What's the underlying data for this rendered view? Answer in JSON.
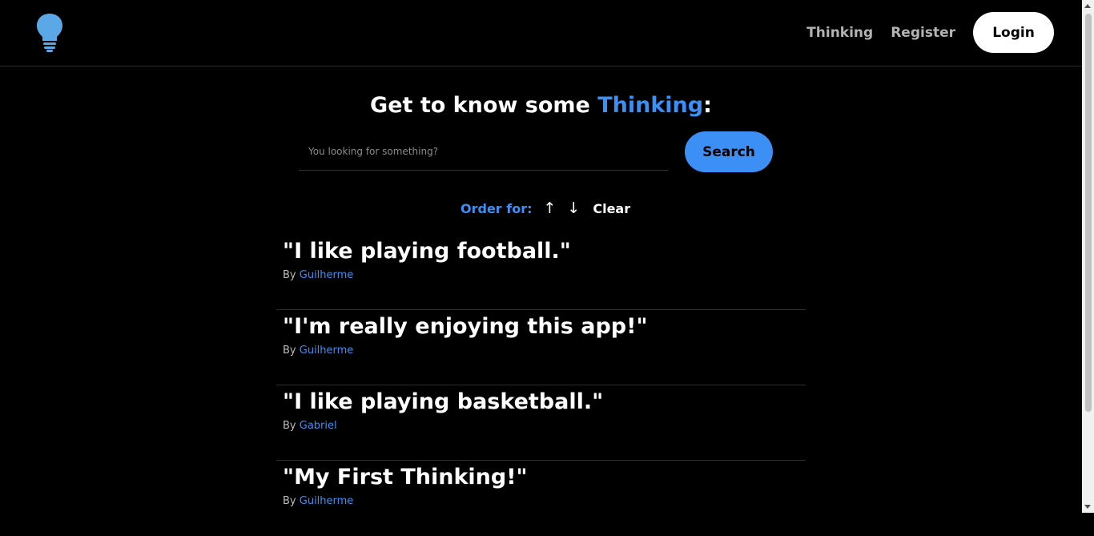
{
  "navbar": {
    "logo_icon": "lightbulb-icon",
    "links": [
      {
        "label": "Thinking"
      },
      {
        "label": "Register"
      }
    ],
    "login_label": "Login"
  },
  "main": {
    "heading_prefix": "Get to know some ",
    "heading_accent": "Thinking",
    "heading_suffix": ":",
    "search": {
      "placeholder": "You looking for something?",
      "value": "",
      "button_label": "Search"
    },
    "order": {
      "label": "Order for:",
      "up_icon": "↑",
      "down_icon": "↓",
      "clear_label": "Clear"
    },
    "thoughts": [
      {
        "quote": "\"I like playing football.\"",
        "by": "By ",
        "author": "Guilherme"
      },
      {
        "quote": "\"I'm really enjoying this app!\"",
        "by": "By ",
        "author": "Guilherme"
      },
      {
        "quote": "\"I like playing basketball.\"",
        "by": "By ",
        "author": "Gabriel"
      },
      {
        "quote": "\"My First Thinking!\"",
        "by": "By ",
        "author": "Guilherme"
      }
    ]
  },
  "colors": {
    "accent": "#3b8ff5",
    "background": "#000000"
  }
}
